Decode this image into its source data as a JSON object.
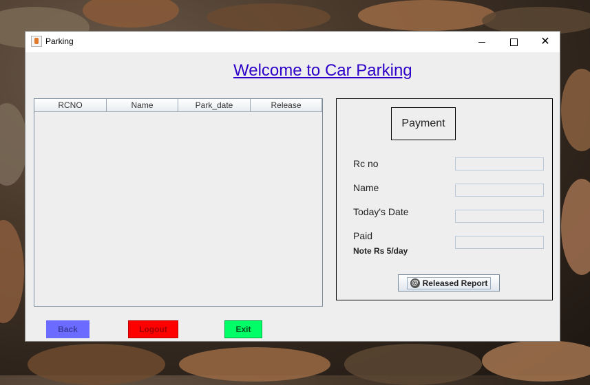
{
  "window": {
    "title": "Parking"
  },
  "heading": "Welcome to Car Parking",
  "table": {
    "columns": [
      "RCNO",
      "Name",
      "Park_date",
      "Release"
    ],
    "rows": []
  },
  "payment": {
    "title": "Payment",
    "fields": [
      {
        "label": "Rc no",
        "value": ""
      },
      {
        "label": "Name",
        "value": ""
      },
      {
        "label": "Today's Date",
        "value": ""
      },
      {
        "label": "Paid",
        "value": ""
      }
    ],
    "note": "Note Rs 5/day",
    "report_button": "Released Report",
    "report_icon": "at-icon"
  },
  "buttons": {
    "back": "Back",
    "logout": "Logout",
    "exit": "Exit"
  },
  "colors": {
    "heading": "#2c00c8",
    "back_button": "#6b6bff",
    "logout_button": "#ff0000",
    "exit_button": "#00ff66"
  }
}
